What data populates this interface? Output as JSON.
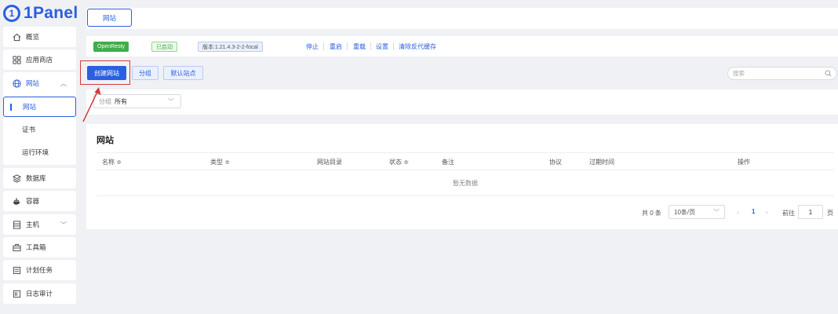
{
  "brand": {
    "logo_glyph": "1",
    "name": "1Panel",
    "color": "#2a5fe0"
  },
  "sidebar": {
    "items": [
      {
        "label": "概览",
        "icon": "home-icon"
      },
      {
        "label": "应用商店",
        "icon": "apps-grid-icon"
      },
      {
        "label": "网站",
        "icon": "globe-icon",
        "expanded": true,
        "sub": [
          "网站",
          "证书",
          "运行环境"
        ]
      },
      {
        "label": "数据库",
        "icon": "database-icon"
      },
      {
        "label": "容器",
        "icon": "docker-icon"
      },
      {
        "label": "主机",
        "icon": "server-icon",
        "has_children": true
      },
      {
        "label": "工具箱",
        "icon": "toolbox-icon"
      },
      {
        "label": "计划任务",
        "icon": "list-icon"
      },
      {
        "label": "日志审计",
        "icon": "log-icon"
      }
    ]
  },
  "tabs": {
    "active": "网站"
  },
  "app_status": {
    "app": "OpenResty",
    "state": "已启动",
    "version": "版本:1.21.4.3-2-2-focal",
    "actions": [
      "停止",
      "重启",
      "重载",
      "设置",
      "清除反代缓存"
    ]
  },
  "toolbar": {
    "create": "创建网站",
    "group": "分组",
    "default_site": "默认站点",
    "search_placeholder": "搜索"
  },
  "filter": {
    "label": "分组",
    "value": "所有"
  },
  "table": {
    "title": "网站",
    "columns": [
      "名称 ≑",
      "类型 ≑",
      "网站目录",
      "状态 ≑",
      "备注",
      "协议",
      "过期时间",
      "操作"
    ],
    "empty_text": "暂无数据"
  },
  "pager": {
    "total": "共 0 条",
    "page_size": "10条/页",
    "current_page": "1",
    "goto_label": "前往",
    "goto_value": "1",
    "unit": "页"
  },
  "colors": {
    "accent": "#2a5fe0",
    "success": "#3fae4b",
    "annotation": "#d63b3b"
  }
}
